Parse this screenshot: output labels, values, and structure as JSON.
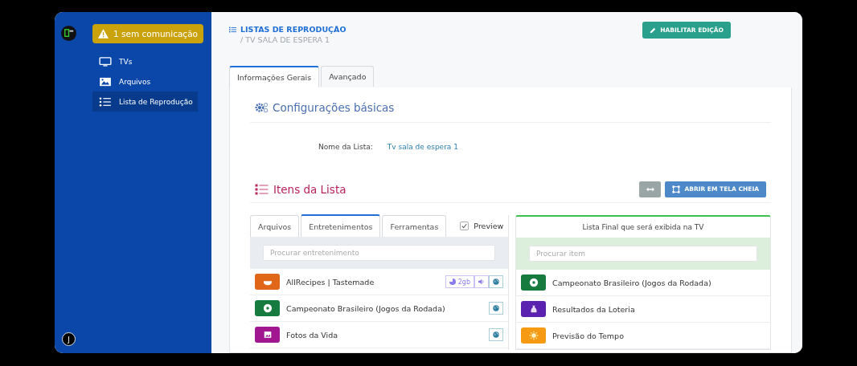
{
  "sidebar": {
    "alert": "1 sem comunicação",
    "items": [
      {
        "label": "TVs",
        "kind": "tv",
        "selected": false
      },
      {
        "label": "Arquivos",
        "kind": "image",
        "selected": false
      },
      {
        "label": "Lista de Reprodução",
        "kind": "list",
        "selected": true
      }
    ],
    "user_initial": "J"
  },
  "header": {
    "title": "LISTAS DE REPRODUÇÃO",
    "subtitle": "/ TV SALA DE ESPERA 1",
    "edit_button": "HABILITAR EDIÇÃO"
  },
  "tabs": [
    {
      "label": "Informações Gerais",
      "selected": true
    },
    {
      "label": "Avançado",
      "selected": false
    }
  ],
  "basic": {
    "title": "Configurações básicas",
    "field_label": "Nome da Lista:",
    "field_value": "Tv sala de espera 1"
  },
  "items": {
    "title": "Itens da Lista",
    "fullscreen_button": "ABRIR EM TELA CHEIA",
    "source_tabs": [
      {
        "label": "Arquivos",
        "selected": false
      },
      {
        "label": "Entretenimentos",
        "selected": true
      },
      {
        "label": "Ferramentas",
        "selected": false
      }
    ],
    "preview": {
      "label": "Preview",
      "checked": true
    },
    "search_placeholder": "Procurar entretenimento",
    "sources": [
      {
        "name": "AllRecipes | Tastemade",
        "kind": "bowl",
        "color": "#e0661a",
        "badges": [
          {
            "kind": "size",
            "text": "2gb"
          },
          {
            "kind": "audio"
          },
          {
            "kind": "web"
          }
        ]
      },
      {
        "name": "Campeonato Brasileiro (Jogos da Rodada)",
        "kind": "ball",
        "color": "#177a3e",
        "badges": [
          {
            "kind": "web"
          }
        ]
      },
      {
        "name": "Fotos da Vida",
        "kind": "image",
        "color": "#a0178f",
        "badges": [
          {
            "kind": "web"
          }
        ]
      }
    ],
    "final": {
      "title": "Lista Final que será exibida na TV",
      "search_placeholder": "Procurar item",
      "items": [
        {
          "name": "Campeonato Brasileiro (Jogos da Rodada)",
          "kind": "ball",
          "color": "#177a3e"
        },
        {
          "name": "Resultados da Loteria",
          "kind": "money",
          "color": "#5b22b0"
        },
        {
          "name": "Previsão do Tempo",
          "kind": "sun",
          "color": "#f59a12"
        }
      ]
    }
  }
}
